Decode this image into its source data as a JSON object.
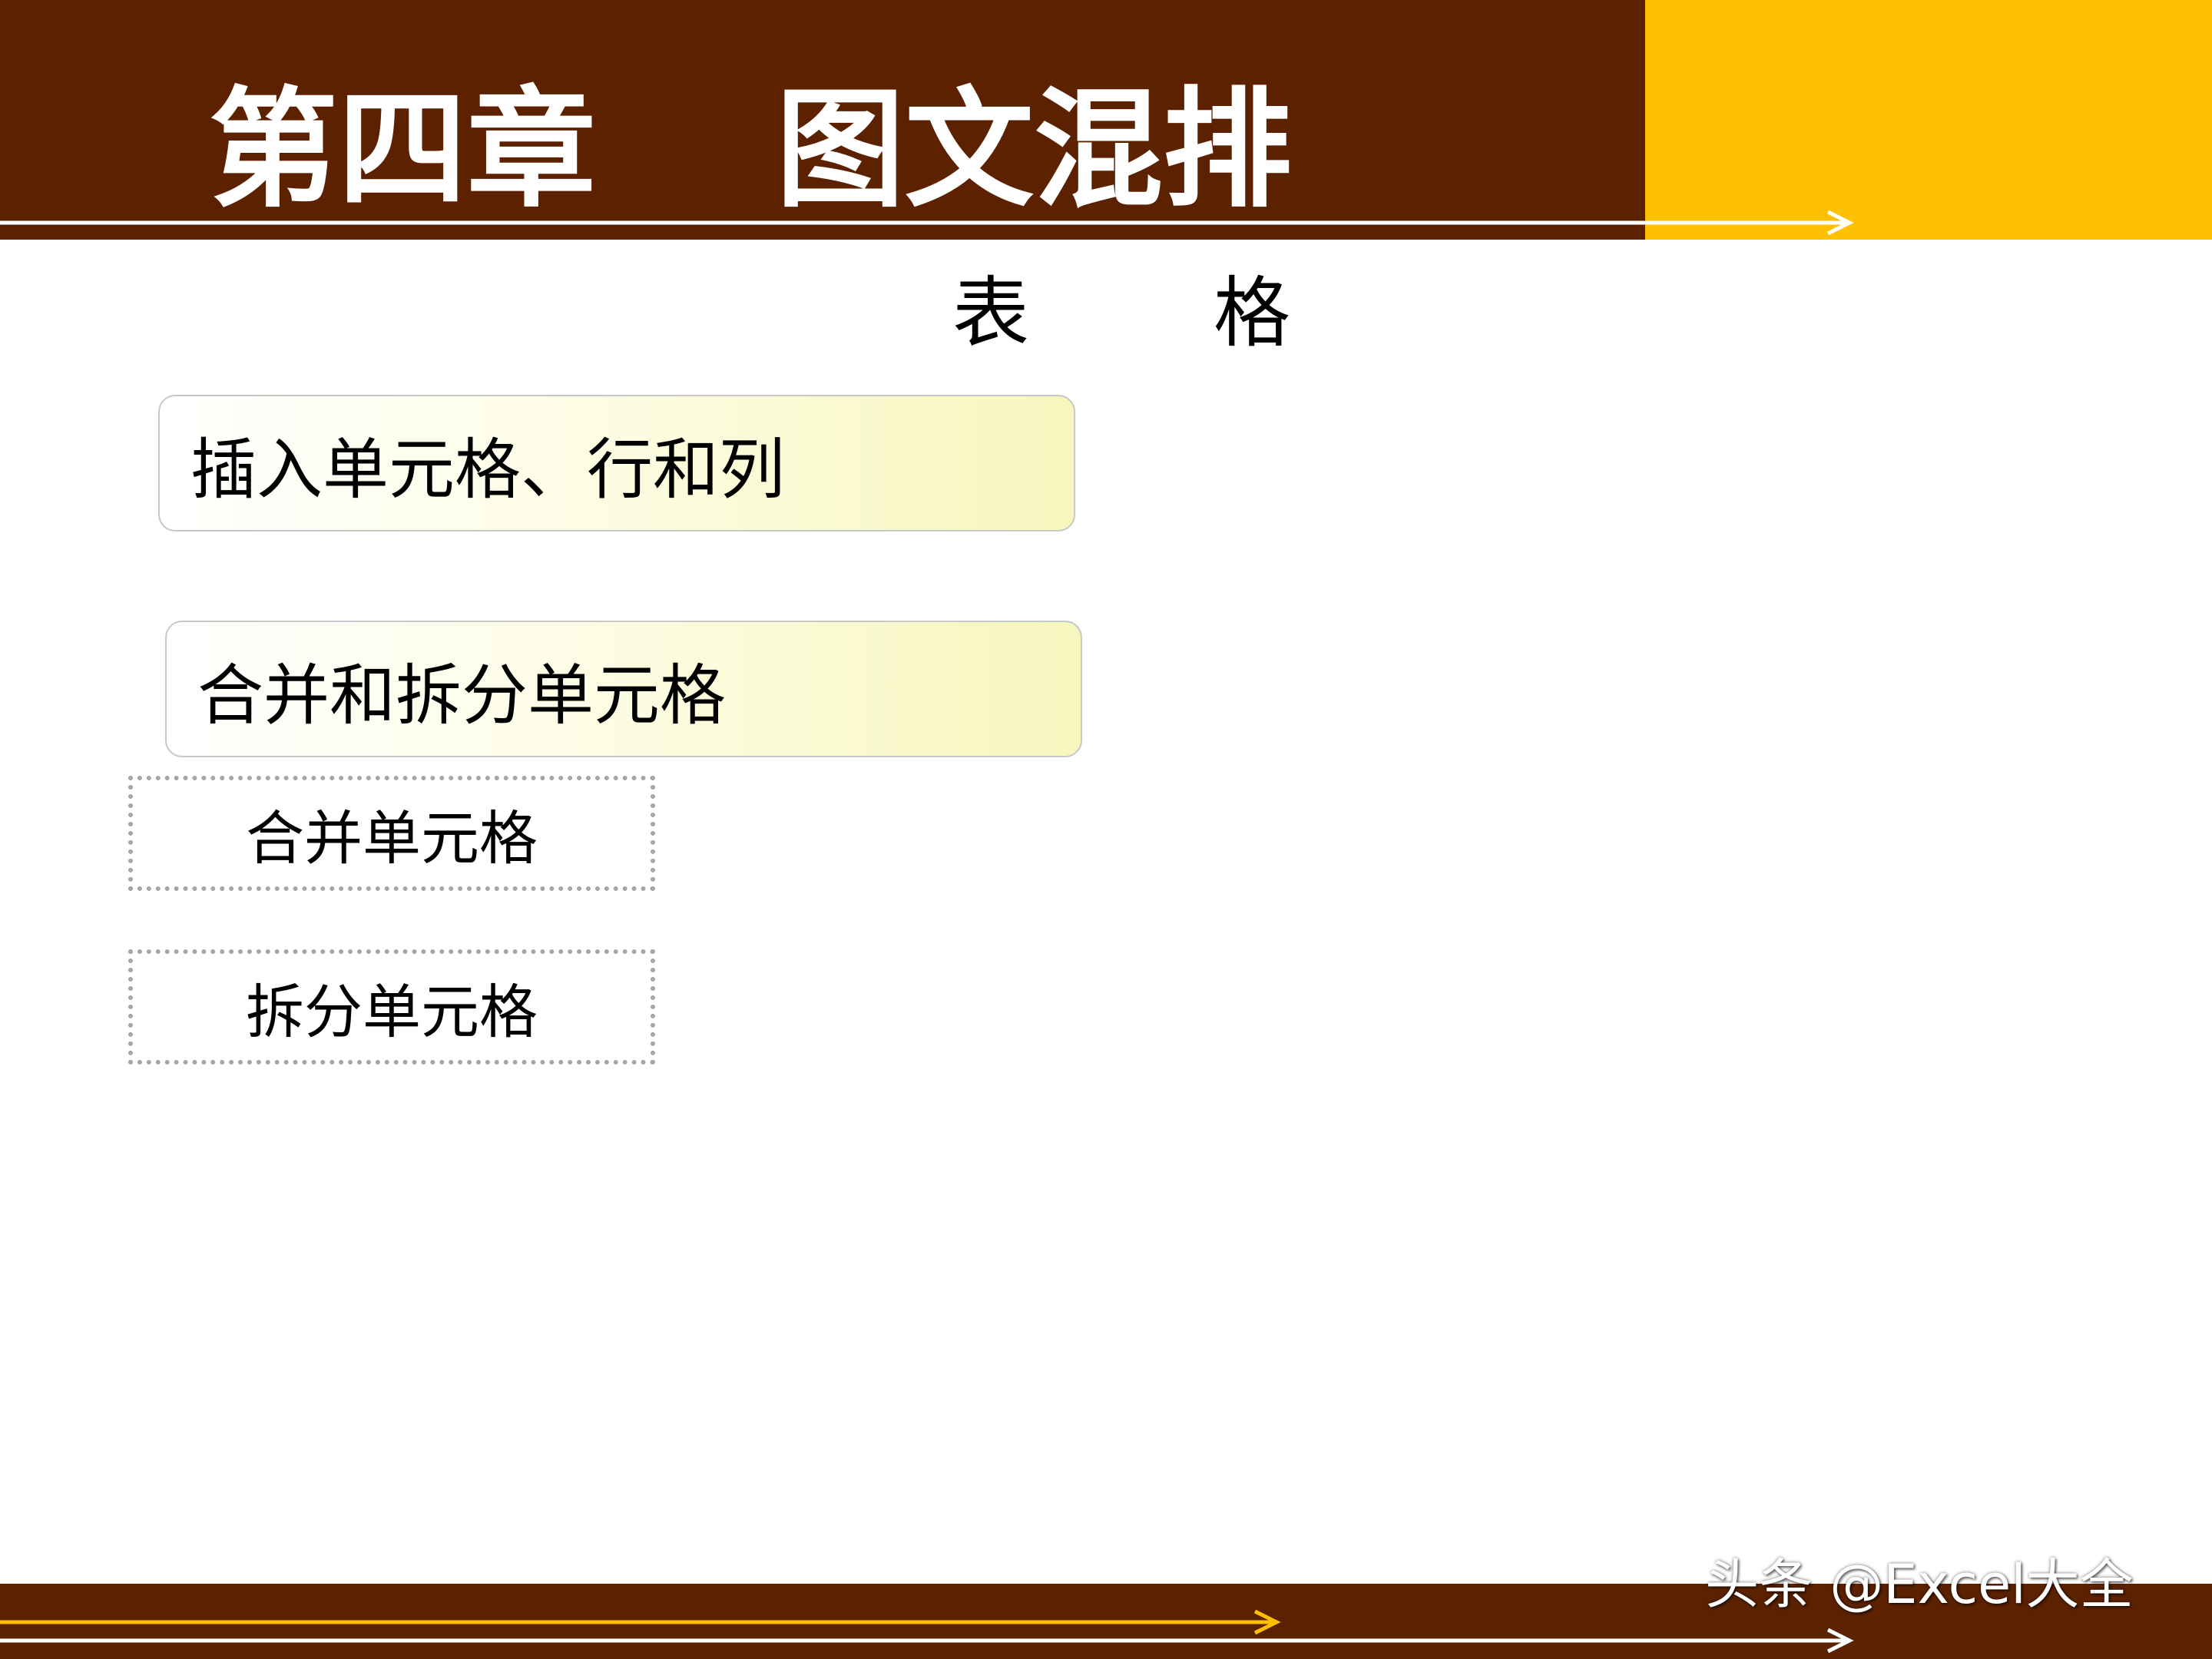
{
  "header": {
    "title": "第四章    图文混排"
  },
  "section": {
    "char1": "表",
    "char2": "格"
  },
  "menu": {
    "insert_label": "插入单元格、行和列",
    "merge_split_label": "合并和拆分单元格"
  },
  "submenu": {
    "merge_label": "合并单元格",
    "split_label": "拆分单元格"
  },
  "watermark": {
    "text": "头条 @Excel大全"
  },
  "colors": {
    "band": "#5c2200",
    "accent": "#fec003",
    "box_gradient_end": "#f7f6bd",
    "dotted_border": "#a6a6a6"
  }
}
